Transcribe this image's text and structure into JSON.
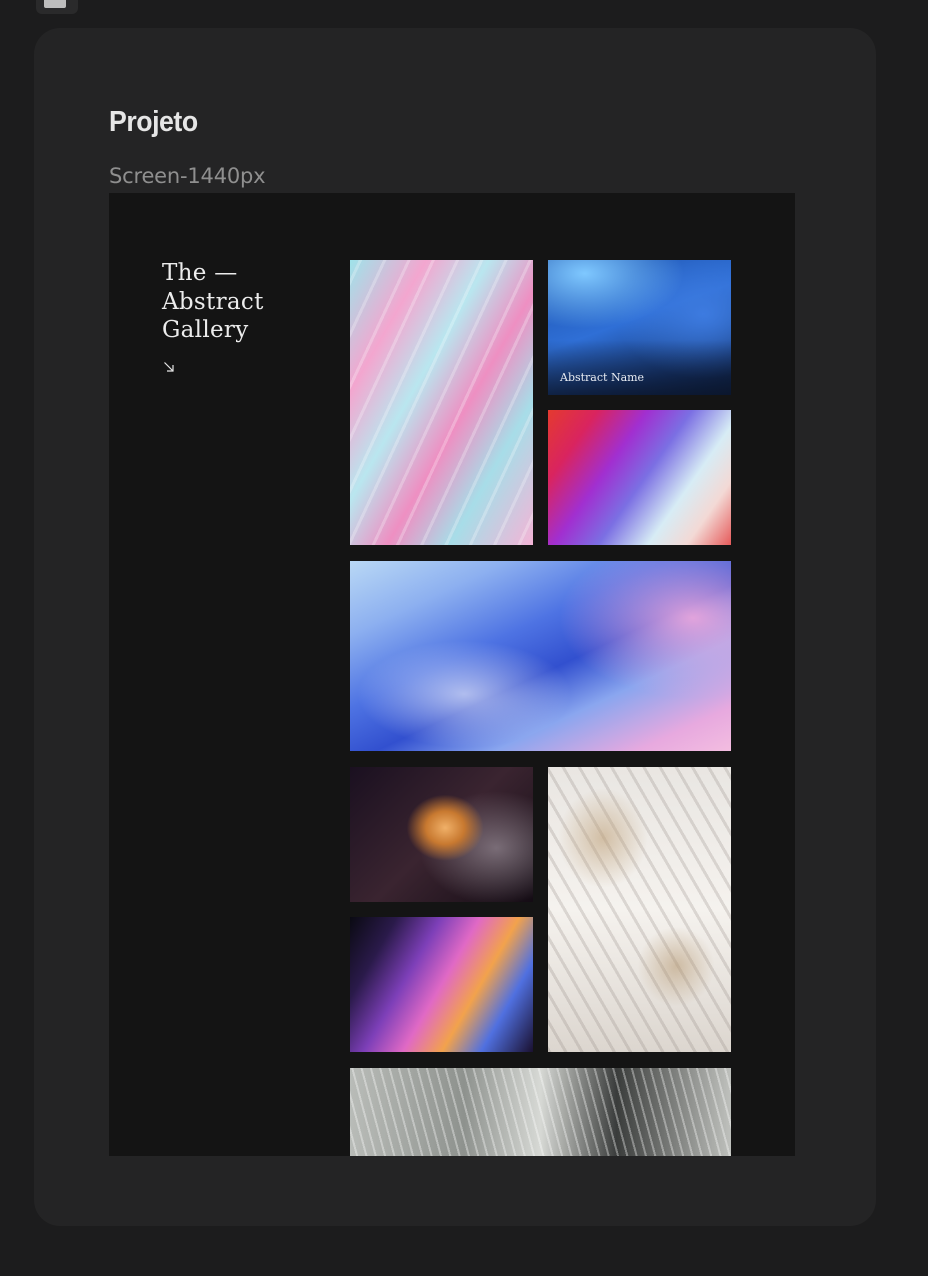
{
  "header": {
    "title": "Projeto",
    "frame_label": "Screen-1440px"
  },
  "gallery": {
    "headline": [
      "The —",
      "Abstract",
      "Gallery"
    ],
    "arrow_icon": "arrow-down-right-icon",
    "tiles": [
      {
        "name": "tile-pink-teal-marble"
      },
      {
        "name": "tile-blue-waves",
        "label": "Abstract Name",
        "selected": true
      },
      {
        "name": "tile-red-violet-gradient"
      },
      {
        "name": "tile-blue-pink-fluid"
      },
      {
        "name": "tile-orange-swirl"
      },
      {
        "name": "tile-white-crumpled"
      },
      {
        "name": "tile-light-streaks"
      },
      {
        "name": "tile-grey-brushstrokes"
      }
    ]
  },
  "colors": {
    "background": "#1c1c1d",
    "card": "#242425",
    "frame": "#141414",
    "selection_border": "#f2f2f2"
  }
}
